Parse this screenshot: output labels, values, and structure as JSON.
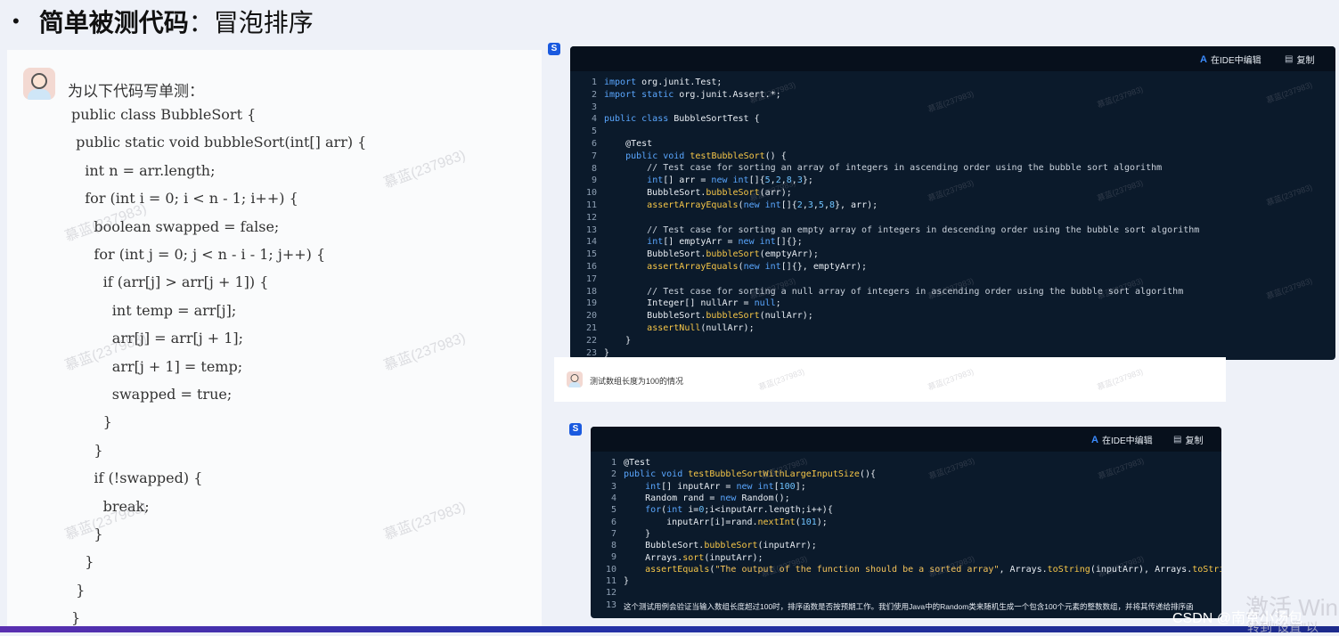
{
  "slide": {
    "bullet": "•",
    "title_bold": "简单被测代码",
    "title_rest": "：冒泡排序"
  },
  "left_chat": {
    "prompt": "为以下代码写单测：",
    "code_lines": [
      "public class BubbleSort {",
      " public static void bubbleSort(int[] arr) {",
      "   int n = arr.length;",
      "   for (int i = 0; i < n - 1; i++) {",
      "     boolean swapped = false;",
      "     for (int j = 0; j < n - i - 1; j++) {",
      "       if (arr[j] > arr[j + 1]) {",
      "         int temp = arr[j];",
      "         arr[j] = arr[j + 1];",
      "         arr[j + 1] = temp;",
      "         swapped = true;",
      "       }",
      "     }",
      "     if (!swapped) {",
      "       break;",
      "     }",
      "   }",
      " }",
      "}"
    ],
    "watermark": "慕蓝(237983)"
  },
  "editor1": {
    "edit_in_ide_label": "在IDE中编辑",
    "copy_label": "复制",
    "line_numbers": [
      "1",
      "2",
      "3",
      "4",
      "5",
      "6",
      "7",
      "8",
      "9",
      "10",
      "11",
      "12",
      "13",
      "14",
      "15",
      "16",
      "17",
      "18",
      "19",
      "20",
      "21",
      "22",
      "23"
    ]
  },
  "user_message": {
    "text": "测试数组长度为100的情况"
  },
  "editor2": {
    "edit_in_ide_label": "在IDE中编辑",
    "copy_label": "复制",
    "line_numbers": [
      "1",
      "2",
      "3",
      "4",
      "5",
      "6",
      "7",
      "8",
      "9",
      "10",
      "11",
      "12",
      "13"
    ],
    "description": "这个测试用例会验证当输入数组长度超过100时，排序函数是否按预期工作。我们使用Java中的Random类来随机生成一个包含100个元素的整数数组，并将其传递给排序函"
  },
  "overlay": {
    "csdn": "CSDN @南京小汤包",
    "activate": "激活 Win",
    "activate_sub": "转到\"设置\"以"
  },
  "colors": {
    "editor_bg": "#0b1a2b",
    "keyword": "#5aa7ff",
    "function": "#f7c748",
    "accent": "#1a5adf"
  }
}
